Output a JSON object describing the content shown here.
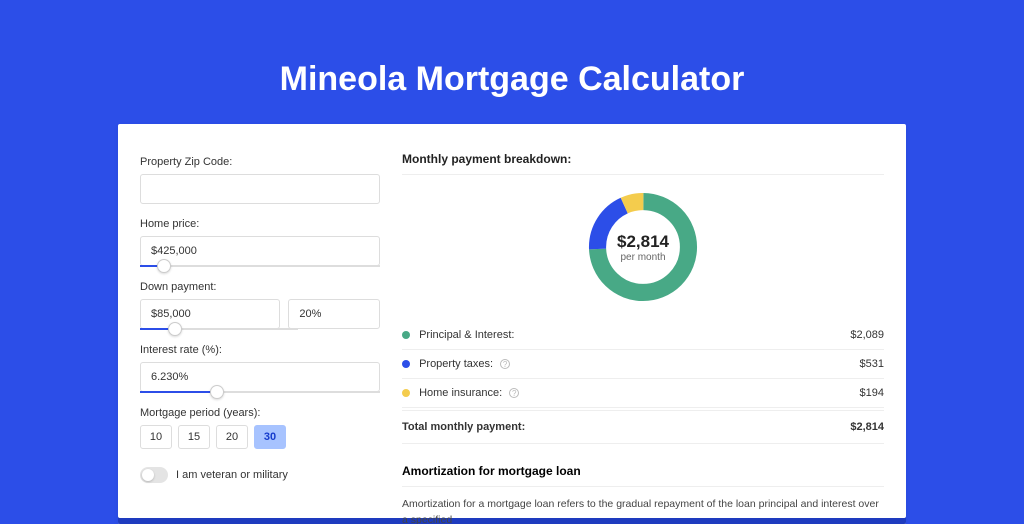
{
  "title": "Mineola Mortgage Calculator",
  "form": {
    "zip_label": "Property Zip Code:",
    "zip_value": "",
    "home_price_label": "Home price:",
    "home_price_value": "$425,000",
    "home_price_slider_pct": 10,
    "down_payment_label": "Down payment:",
    "down_payment_value": "$85,000",
    "down_payment_pct": "20%",
    "down_payment_slider_pct": 22,
    "interest_label": "Interest rate (%):",
    "interest_value": "6.230%",
    "interest_slider_pct": 32,
    "period_label": "Mortgage period (years):",
    "periods": [
      "10",
      "15",
      "20",
      "30"
    ],
    "period_active_index": 3,
    "veteran_label": "I am veteran or military"
  },
  "breakdown": {
    "title": "Monthly payment breakdown:",
    "center_value": "$2,814",
    "center_label": "per month",
    "items": [
      {
        "label": "Principal & Interest:",
        "value": "$2,089",
        "has_info": false
      },
      {
        "label": "Property taxes:",
        "value": "$531",
        "has_info": true
      },
      {
        "label": "Home insurance:",
        "value": "$194",
        "has_info": true
      }
    ],
    "total_label": "Total monthly payment:",
    "total_value": "$2,814"
  },
  "amortization": {
    "title": "Amortization for mortgage loan",
    "text": "Amortization for a mortgage loan refers to the gradual repayment of the loan principal and interest over a specified"
  },
  "chart_data": {
    "type": "pie",
    "title": "Monthly payment breakdown",
    "series": [
      {
        "name": "Principal & Interest",
        "value": 2089,
        "color": "#48a986"
      },
      {
        "name": "Property taxes",
        "value": 531,
        "color": "#2c4ee8"
      },
      {
        "name": "Home insurance",
        "value": 194,
        "color": "#f4cc4d"
      }
    ],
    "total": 2814,
    "unit": "USD per month"
  }
}
